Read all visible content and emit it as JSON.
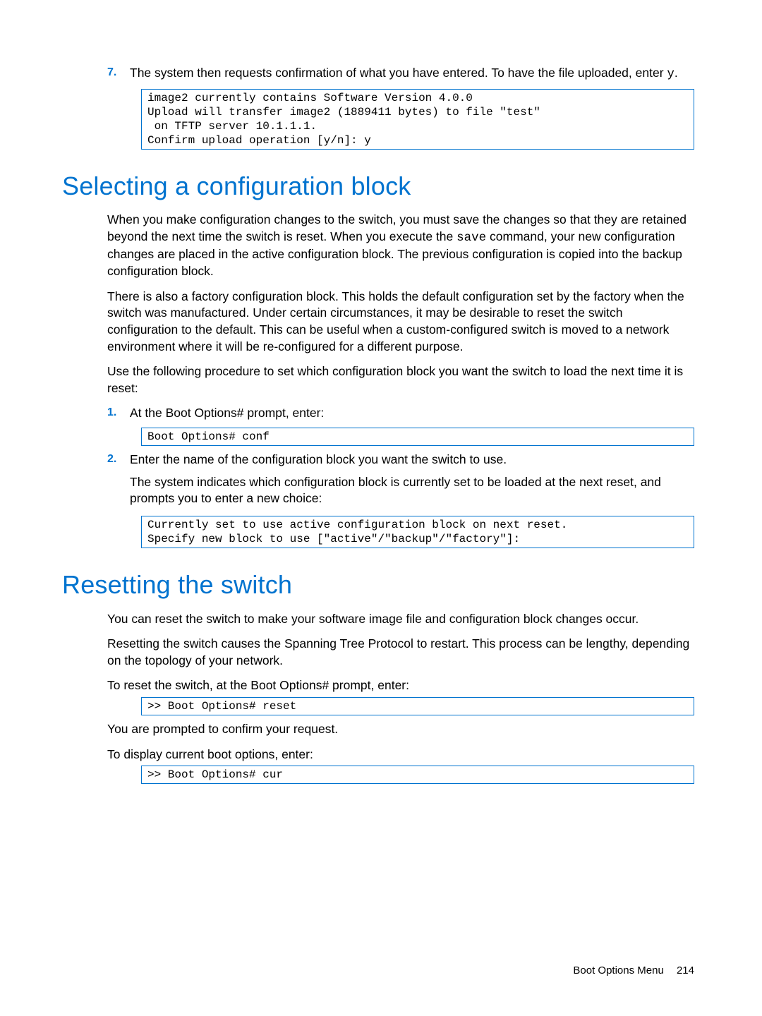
{
  "step7": {
    "num": "7.",
    "text_before": "The system then requests confirmation of what you have entered. To have the file uploaded, enter ",
    "text_code": "y",
    "text_after": ".",
    "code": "image2 currently contains Software Version 4.0.0\nUpload will transfer image2 (1889411 bytes) to file \"test\"\n on TFTP server 10.1.1.1.\nConfirm upload operation [y/n]: y"
  },
  "section1": {
    "heading": "Selecting a configuration block",
    "p1_before": "When you make configuration changes to the switch, you must save the changes so that they are retained beyond the next time the switch is reset. When you execute the ",
    "p1_code": "save",
    "p1_after": " command, your new configuration changes are placed in the active configuration block. The previous configuration is copied into the backup configuration block.",
    "p2": "There is also a factory configuration block. This holds the default configuration set by the factory when the switch was manufactured. Under certain circumstances, it may be desirable to reset the switch configuration to the default. This can be useful when a custom-configured switch is moved to a network environment where it will be re-configured for a different purpose.",
    "p3": "Use the following procedure to set which configuration block you want the switch to load the next time it is reset:",
    "step1": {
      "num": "1.",
      "text": "At the Boot Options# prompt, enter:",
      "code": "Boot Options# conf"
    },
    "step2": {
      "num": "2.",
      "text": "Enter the name of the configuration block you want the switch to use.",
      "p": "The system indicates which configuration block is currently set to be loaded at the next reset, and prompts you to enter a new choice:",
      "code": "Currently set to use active configuration block on next reset.\nSpecify new block to use [\"active\"/\"backup\"/\"factory\"]:"
    }
  },
  "section2": {
    "heading": "Resetting the switch",
    "p1": "You can reset the switch to make your software image file and configuration block changes occur.",
    "p2": "Resetting the switch causes the Spanning Tree Protocol to restart. This process can be lengthy, depending on the topology of your network.",
    "p3": "To reset the switch, at the Boot Options# prompt, enter:",
    "code1": ">> Boot Options# reset",
    "p4": "You are prompted to confirm your request.",
    "p5": "To display current boot options, enter:",
    "code2": ">> Boot Options# cur"
  },
  "footer": {
    "section": "Boot Options Menu",
    "page": "214"
  }
}
